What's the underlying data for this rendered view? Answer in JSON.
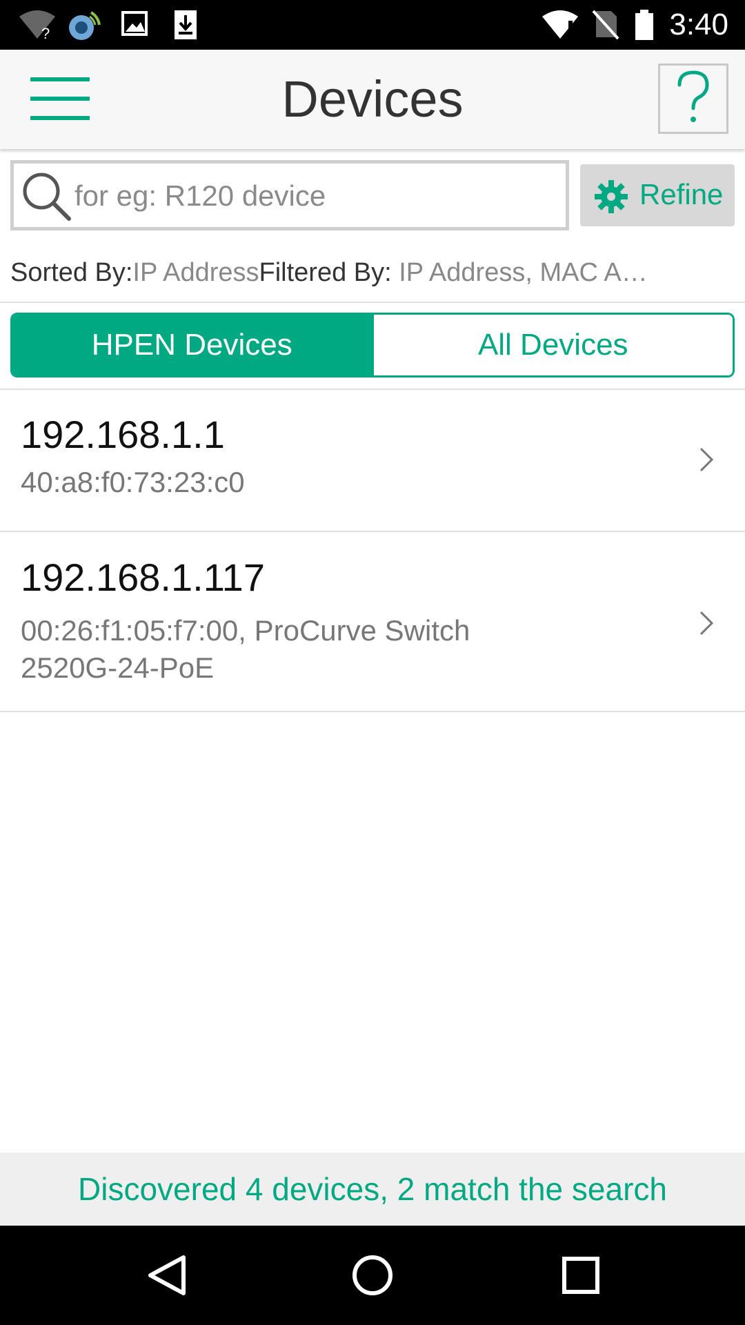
{
  "status_bar": {
    "time": "3:40",
    "icons": [
      "wifi-unknown-icon",
      "sync-app-icon",
      "image-notification-icon",
      "download-icon",
      "wifi-alert-icon",
      "no-sim-icon",
      "battery-icon"
    ]
  },
  "app_bar": {
    "title": "Devices",
    "menu_icon": "hamburger-menu-icon",
    "help_icon": "question-mark-icon"
  },
  "search": {
    "placeholder": "for eg: R120 device",
    "value": "",
    "refine_label": "Refine"
  },
  "sort_filter": {
    "sorted_label": "Sorted By:",
    "sorted_value": "IP Address",
    "filtered_label": "Filtered By:",
    "filtered_value": " IP Address, MAC A…"
  },
  "tabs": [
    {
      "label": "HPEN Devices",
      "active": true
    },
    {
      "label": "All Devices",
      "active": false
    }
  ],
  "devices": [
    {
      "ip": "192.168.1.1",
      "detail_line1": "40:a8:f0:73:23:c0",
      "detail_line2": ""
    },
    {
      "ip": "192.168.1.117",
      "detail_line1": "00:26:f1:05:f7:00, ProCurve Switch",
      "detail_line2": "2520G-24-PoE"
    }
  ],
  "footer": {
    "status": "Discovered 4 devices, 2 match the search"
  },
  "colors": {
    "accent": "#01a982",
    "appbar_bg": "#f7f7f7",
    "footer_bg": "#efefef"
  },
  "nav_bar": {
    "icons": [
      "back-triangle-icon",
      "home-circle-icon",
      "recents-square-icon"
    ]
  }
}
